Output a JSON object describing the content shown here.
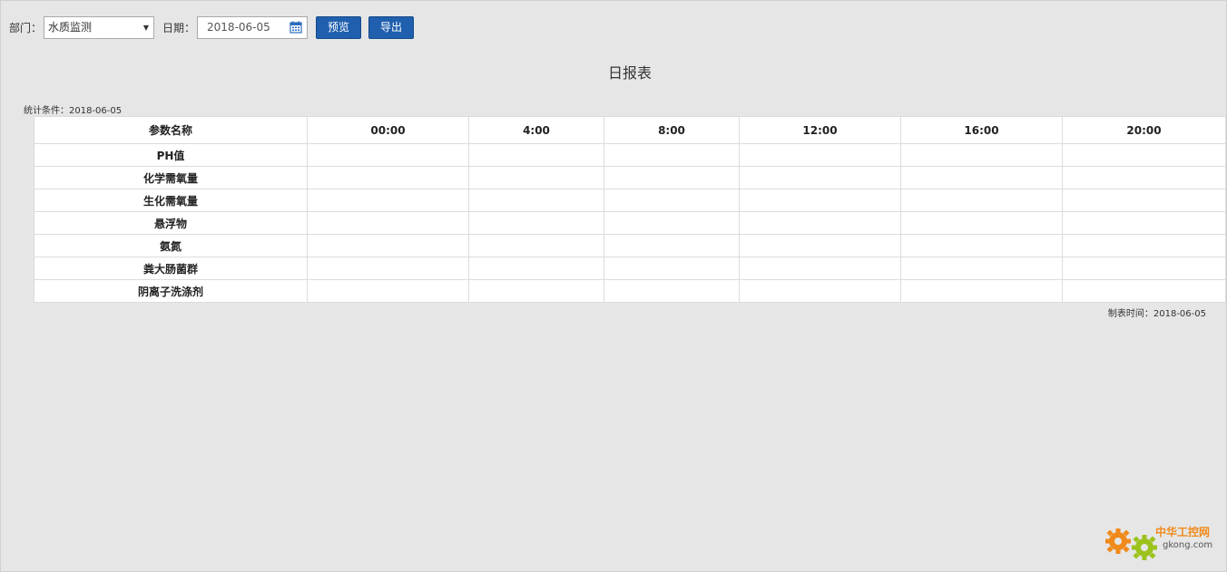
{
  "toolbar": {
    "dept_label": "部门：",
    "dept_value": "水质监测",
    "date_label": "日期：",
    "date_value": "2018-06-05",
    "preview_label": "预览",
    "export_label": "导出"
  },
  "report": {
    "title": "日报表",
    "condition": "统计条件：2018-06-05",
    "made_time": "制表时间：2018-06-05",
    "columns": [
      "参数名称",
      "00:00",
      "4:00",
      "8:00",
      "12:00",
      "16:00",
      "20:00"
    ],
    "rows": [
      "PH值",
      "化学需氧量",
      "生化需氧量",
      "悬浮物",
      "氨氮",
      "粪大肠菌群",
      "阴离子洗涤剂"
    ]
  },
  "watermark": {
    "cn": "中华工控网",
    "url": "gkong.com",
    "gear_color_1": "#f08a1c",
    "gear_color_2": "#9bc31c"
  }
}
